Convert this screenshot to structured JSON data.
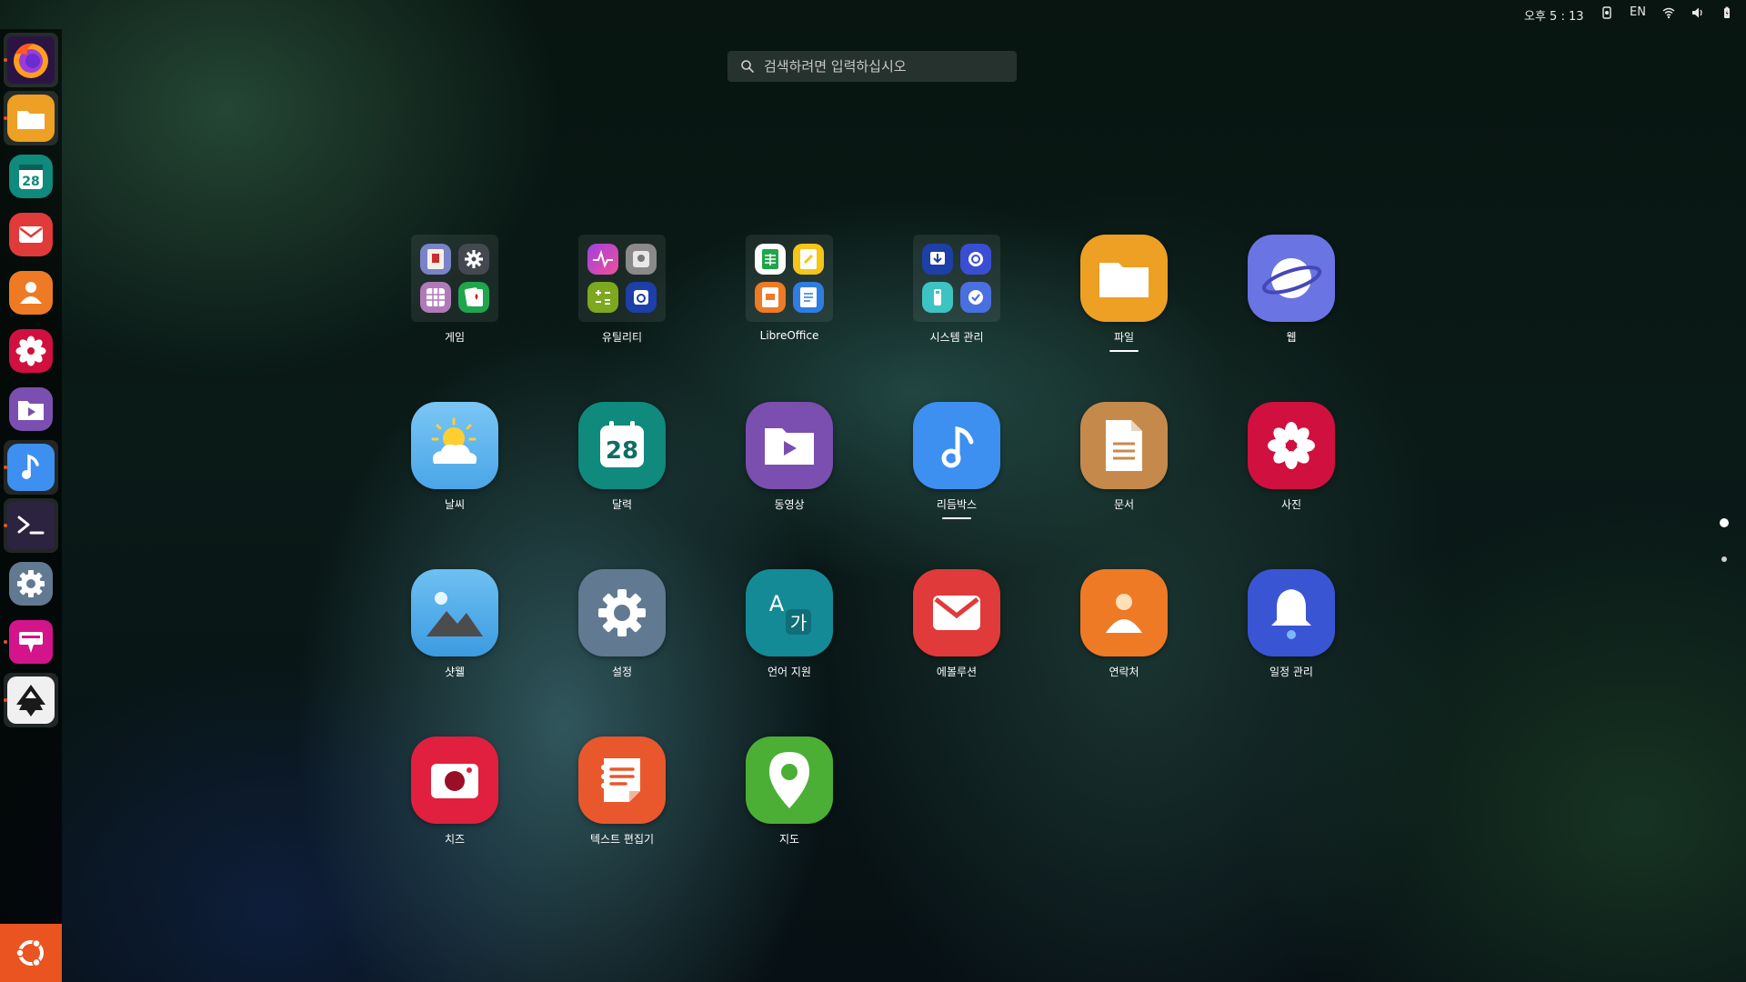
{
  "topbar": {
    "clock": "오후 5 : 13",
    "lang": "EN",
    "icons": [
      "screen-record-icon",
      "wifi-icon",
      "volume-icon",
      "battery-icon"
    ]
  },
  "search": {
    "placeholder": "검색하려면 입력하십시오"
  },
  "dock": {
    "items": [
      {
        "name": "firefox",
        "icon": "firefox-icon"
      },
      {
        "name": "files",
        "icon": "folder-icon"
      },
      {
        "name": "calendar",
        "icon": "calendar-icon",
        "text": "28"
      },
      {
        "name": "email",
        "icon": "mail-icon"
      },
      {
        "name": "contacts",
        "icon": "contact-icon"
      },
      {
        "name": "photos",
        "icon": "flower-icon"
      },
      {
        "name": "videos",
        "icon": "video-folder-icon"
      },
      {
        "name": "rhythmbox",
        "icon": "music-note-icon"
      },
      {
        "name": "terminal",
        "icon": "terminal-icon"
      },
      {
        "name": "settings",
        "icon": "gear-icon"
      },
      {
        "name": "screenshot",
        "icon": "presentation-icon"
      },
      {
        "name": "inkscape",
        "icon": "inkscape-icon"
      }
    ],
    "show_apps_icon": "ubuntu-logo-icon"
  },
  "apps": {
    "row1": [
      {
        "label": "게임",
        "kind": "folder"
      },
      {
        "label": "유틸리티",
        "kind": "folder"
      },
      {
        "label": "LibreOffice",
        "kind": "folder"
      },
      {
        "label": "시스템 관리",
        "kind": "folder"
      },
      {
        "label": "파일",
        "kind": "app",
        "running": true
      },
      {
        "label": "웹",
        "kind": "app"
      }
    ],
    "row2": [
      {
        "label": "날씨"
      },
      {
        "label": "달력",
        "text": "28"
      },
      {
        "label": "동영상"
      },
      {
        "label": "리듬박스",
        "running": true
      },
      {
        "label": "문서"
      },
      {
        "label": "사진"
      }
    ],
    "row3": [
      {
        "label": "샷웰"
      },
      {
        "label": "설정"
      },
      {
        "label": "언어 지원",
        "glyph_a": "A",
        "glyph_b": "가"
      },
      {
        "label": "에볼루션"
      },
      {
        "label": "연락처"
      },
      {
        "label": "일정 관리"
      }
    ],
    "row4": [
      {
        "label": "치즈"
      },
      {
        "label": "텍스트 편집기"
      },
      {
        "label": "지도"
      }
    ]
  },
  "pager": {
    "pages": 2,
    "current": 1
  },
  "colors": {
    "accent": "#e95420",
    "files": "#eda023",
    "web": "#6b74e3",
    "weather": "#62b6f0",
    "calendar": "#0f8a7c",
    "videos": "#7a4fb0",
    "rhythmbox": "#3d8ff0",
    "documents": "#c58a4b",
    "photos": "#d0103e",
    "shotwell": "#4aa6e8",
    "settings": "#617a92",
    "language": "#148a96",
    "evolution": "#e03a3a",
    "contacts": "#ee7a25",
    "schedule": "#3a55d4",
    "cheese": "#e0203e",
    "texteditor": "#e8582c",
    "maps": "#4caf35"
  }
}
